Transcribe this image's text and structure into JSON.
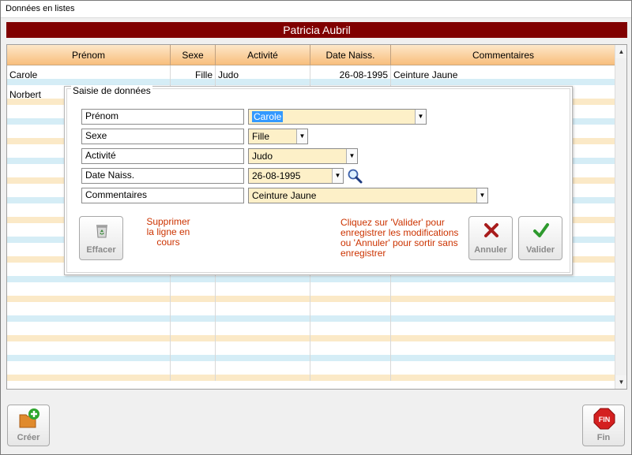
{
  "window": {
    "title": "Données en listes"
  },
  "banner": {
    "name": "Patricia Aubril"
  },
  "table": {
    "columns": [
      "Prénom",
      "Sexe",
      "Activité",
      "Date Naiss.",
      "Commentaires"
    ],
    "rows": [
      [
        "Carole",
        "Fille",
        "Judo",
        "26-08-1995",
        "Ceinture Jaune"
      ],
      [
        "Norbert",
        "",
        "",
        "",
        ""
      ]
    ]
  },
  "dialog": {
    "legend": "Saisie de données",
    "fields": [
      {
        "label": "Prénom",
        "value": "Carole"
      },
      {
        "label": "Sexe",
        "value": "Fille"
      },
      {
        "label": "Activité",
        "value": "Judo"
      },
      {
        "label": "Date Naiss.",
        "value": "26-08-1995"
      },
      {
        "label": "Commentaires",
        "value": "Ceinture Jaune"
      }
    ],
    "delete_button": "Effacer",
    "delete_note": [
      "Supprimer",
      "la ligne en",
      "cours"
    ],
    "help_note": [
      "Cliquez sur 'Valider' pour",
      "enregistrer les modifications",
      "ou 'Annuler' pour sortir sans",
      "enregistrer"
    ],
    "cancel_button": "Annuler",
    "validate_button": "Valider"
  },
  "footer": {
    "create_button": "Créer",
    "end_button": "Fin",
    "end_icon_text": "FIN"
  },
  "colors": {
    "banner": "#800000",
    "note": "#cc3300",
    "field_bg": "#fdf0c8",
    "header_orange": "#f8be7c"
  },
  "icons": [
    "trash-icon",
    "x-icon",
    "check-icon",
    "magnifier-icon",
    "create-folder-icon",
    "stop-sign-icon",
    "dropdown-arrow-icon",
    "scroll-up-icon",
    "scroll-down-icon"
  ]
}
